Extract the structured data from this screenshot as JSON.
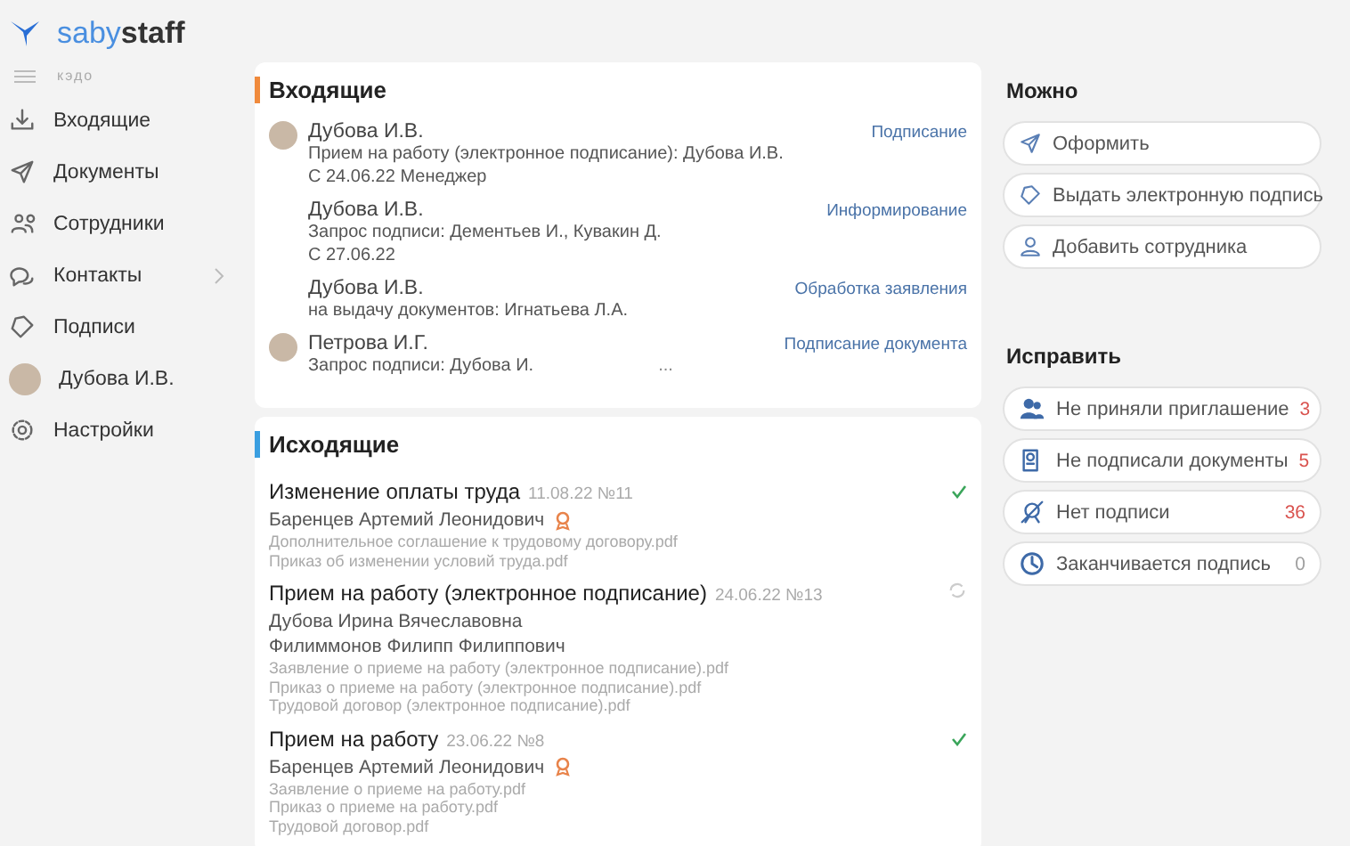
{
  "logo": {
    "part_1": "saby",
    "part_2": "staff"
  },
  "sidebar": {
    "subtitle": "кэдо",
    "items": [
      {
        "label": "Входящие",
        "kind": "icon",
        "expandable": false
      },
      {
        "label": "Документы",
        "kind": "icon",
        "expandable": false
      },
      {
        "label": "Сотрудники",
        "kind": "icon",
        "expandable": false
      },
      {
        "label": "Контакты",
        "kind": "icon",
        "expandable": true
      },
      {
        "label": "Подписи",
        "kind": "icon",
        "expandable": false
      },
      {
        "label": "Дубова И.В.",
        "kind": "avatar",
        "expandable": false
      },
      {
        "label": "Настройки",
        "kind": "icon",
        "expandable": false
      }
    ]
  },
  "incoming": {
    "title": "Входящие",
    "items": [
      {
        "name": "Дубова И.В.",
        "avatar": true,
        "action": "Подписание",
        "lines": [
          "Прием на работу (электронное подписание): Дубова И.В.",
          "С 24.06.22 Менеджер"
        ]
      },
      {
        "name": "Дубова И.В.",
        "avatar": false,
        "action": "Информирование",
        "lines": [
          "Запрос подписи: Дементьев И., Кувакин Д.",
          "С 27.06.22"
        ]
      },
      {
        "name": "Дубова И.В.",
        "avatar": false,
        "action": "Обработка заявления",
        "lines": [
          "на выдачу документов: Игнатьева Л.А."
        ]
      },
      {
        "name": "Петрова И.Г.",
        "avatar": true,
        "action": "Подписание документа",
        "lines": [
          "Запрос подписи: Дубова И."
        ]
      }
    ],
    "more": "..."
  },
  "outgoing": {
    "title": "Исходящие",
    "items": [
      {
        "title": "Изменение оплаты труда",
        "meta": "11.08.22 №11",
        "completed": true,
        "people": [
          {
            "name": "Баренцев Артемий Леонидович",
            "signed": true
          }
        ],
        "files": [
          "Дополнительное соглашение к трудовому договору.pdf",
          "Приказ об изменении условий труда.pdf"
        ]
      },
      {
        "title": "Прием на работу (электронное подписание)",
        "meta": "24.06.22 №13",
        "completed": false,
        "people": [
          {
            "name": "Дубова Ирина Вячеславовна",
            "signed": false
          },
          {
            "name": "Филиммонов Филипп Филиппович",
            "signed": false
          }
        ],
        "files": [
          "Заявление о приеме на работу (электронное подписание).pdf",
          "Приказ о приеме на работу (электронное подписание).pdf",
          "Трудовой договор (электронное подписание).pdf"
        ]
      },
      {
        "title": "Прием на работу",
        "meta": "23.06.22 №8",
        "completed": true,
        "people": [
          {
            "name": "Баренцев Артемий Леонидович",
            "signed": true
          }
        ],
        "files": [
          "Заявление о приеме на работу.pdf",
          "Приказ о приеме на работу.pdf",
          "Трудовой договор.pdf"
        ]
      }
    ]
  },
  "can": {
    "title": "Можно",
    "actions": [
      {
        "label": "Оформить"
      },
      {
        "label": "Выдать электронную подпись"
      },
      {
        "label": "Добавить сотрудника"
      }
    ]
  },
  "fix": {
    "title": "Исправить",
    "items": [
      {
        "label": "Не приняли приглашение",
        "count": "3",
        "color": "#d9534f"
      },
      {
        "label": "Не подписали документы",
        "count": "5",
        "color": "#d9534f"
      },
      {
        "label": "Нет подписи",
        "count": "36",
        "color": "#d9534f"
      },
      {
        "label": "Заканчивается подпись",
        "count": "0",
        "color": "#a0a0a0"
      }
    ]
  }
}
